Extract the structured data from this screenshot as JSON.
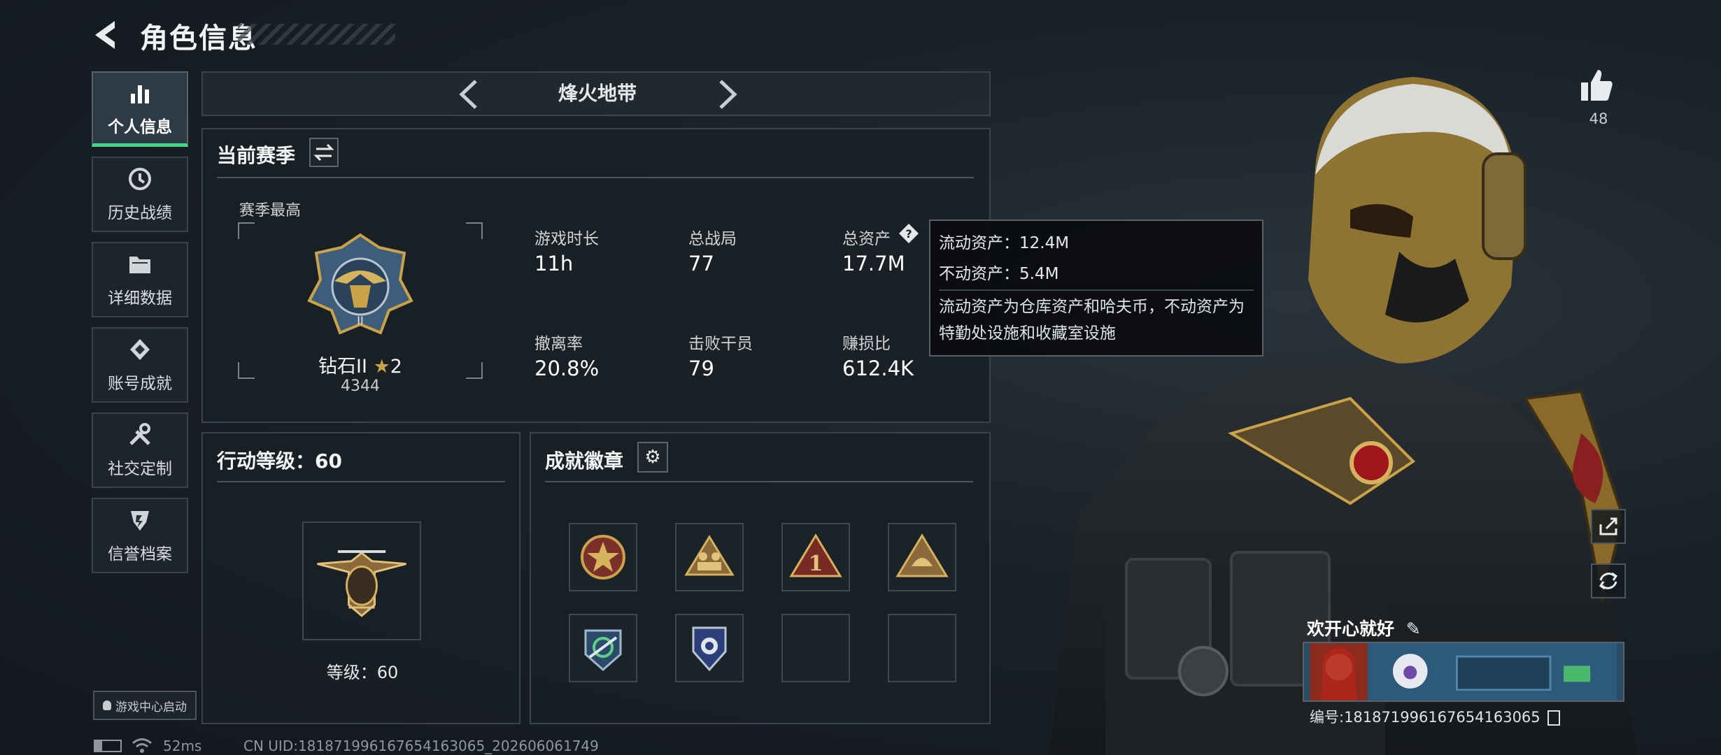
{
  "header": {
    "title": "角色信息"
  },
  "sidebar": {
    "items": [
      {
        "label": "个人信息",
        "icon": "bar-chart-icon",
        "active": true
      },
      {
        "label": "历史战绩",
        "icon": "history-clock-icon",
        "active": false
      },
      {
        "label": "详细数据",
        "icon": "folder-icon",
        "active": false
      },
      {
        "label": "账号成就",
        "icon": "achievement-diamond-icon",
        "active": false
      },
      {
        "label": "社交定制",
        "icon": "tools-icon",
        "active": false
      },
      {
        "label": "信誉档案",
        "icon": "shield-icon",
        "active": false
      }
    ],
    "game_center_label": "游戏中心启动"
  },
  "mode": {
    "title": "烽火地带"
  },
  "season": {
    "title": "当前赛季",
    "best_label": "赛季最高",
    "rank_name": "钻石II",
    "rank_stars": "2",
    "rank_points": "4344",
    "stats": [
      {
        "label": "游戏时长",
        "value": "11h"
      },
      {
        "label": "总战局",
        "value": "77"
      },
      {
        "label": "总资产",
        "value": "17.7M"
      },
      {
        "label": "撤离率",
        "value": "20.8%"
      },
      {
        "label": "击败干员",
        "value": "79"
      },
      {
        "label": "赚损比",
        "value": "612.4K"
      }
    ]
  },
  "tooltip": {
    "liquid": "流动资产：12.4M",
    "fixed": "不动资产：5.4M",
    "description": "流动资产为仓库资产和哈夫币，不动资产为特勤处设施和收藏室设施"
  },
  "level": {
    "title": "行动等级：60",
    "caption": "等级：60"
  },
  "badges": {
    "title": "成就徽章"
  },
  "profile": {
    "likes": "48",
    "name": "欢开心就好",
    "id": "编号:1818719961676541630​65"
  },
  "status": {
    "latency": "52ms",
    "uid": "CN UID:181871996167654163065_202606061749"
  },
  "colors": {
    "accent": "#4ad38a",
    "panel": "#181f25",
    "border": "#3a444c",
    "gold": "#c9a24a"
  }
}
